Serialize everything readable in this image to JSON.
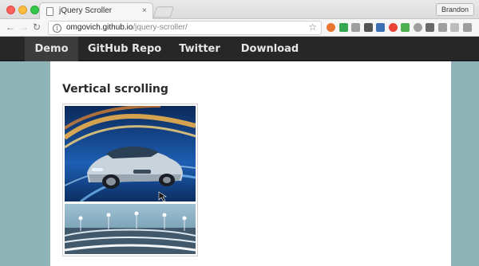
{
  "browser": {
    "tab_title": "jQuery Scroller",
    "tab_close": "×",
    "profile_name": "Brandon",
    "url_host": "omgovich.github.io",
    "url_path": "/jquery-scroller/",
    "back_glyph": "←",
    "forward_glyph": "→",
    "reload_glyph": "↻",
    "info_glyph": "i",
    "star_glyph": "☆",
    "extension_colors": [
      "#e8742f",
      "#34a853",
      "#9e9e9e",
      "#555555",
      "#3d6fb6",
      "#ea4335",
      "#4caf50",
      "#9e9e9e",
      "#6a6a6a",
      "#9e9e9e",
      "#bdbdbd",
      "#9e9e9e"
    ]
  },
  "site_nav": {
    "items": [
      {
        "label": "Demo",
        "active": true
      },
      {
        "label": "GitHub Repo",
        "active": false
      },
      {
        "label": "Twitter",
        "active": false
      },
      {
        "label": "Download",
        "active": false
      }
    ]
  },
  "main": {
    "section_title": "Vertical scrolling"
  },
  "colors": {
    "nav_bg": "#272727",
    "nav_active_bg": "#3c3c3c",
    "page_bg": "#8fb4b8",
    "content_bg": "#ffffff"
  }
}
